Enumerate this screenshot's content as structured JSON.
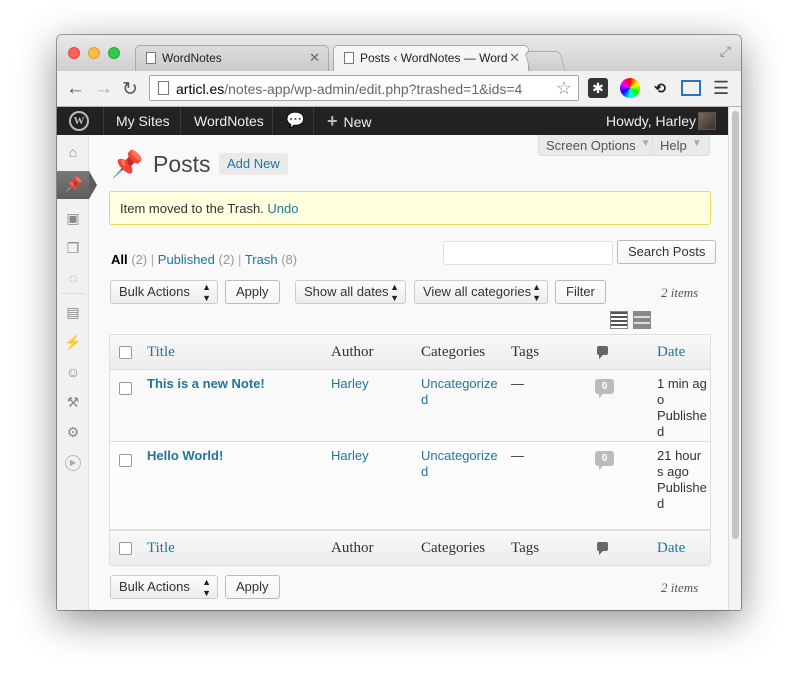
{
  "browser": {
    "tabs": [
      {
        "label": "WordNotes"
      },
      {
        "label": "Posts ‹ WordNotes — Word"
      }
    ],
    "url_host": "articl.es",
    "url_path": "/notes-app/wp-admin/edit.php?trashed=1&ids=4"
  },
  "adminbar": {
    "my_sites": "My Sites",
    "site_name": "WordNotes",
    "new": "New",
    "howdy": "Howdy, Harley"
  },
  "header": {
    "screen_options": "Screen Options",
    "help": "Help",
    "title": "Posts",
    "add_new": "Add New"
  },
  "notice": {
    "text": "Item moved to the Trash.",
    "undo": "Undo"
  },
  "filters": {
    "all_label": "All",
    "all_count": "(2)",
    "published_label": "Published",
    "published_count": "(2)",
    "trash_label": "Trash",
    "trash_count": "(8)",
    "sep": "|"
  },
  "search": {
    "button": "Search Posts",
    "placeholder": ""
  },
  "tablenav": {
    "bulk_actions": "Bulk Actions",
    "apply": "Apply",
    "dates": "Show all dates",
    "categories": "View all categories",
    "filter": "Filter",
    "items": "2 items"
  },
  "table": {
    "columns": {
      "title": "Title",
      "author": "Author",
      "categories": "Categories",
      "tags": "Tags",
      "date": "Date"
    },
    "rows": [
      {
        "title": "This is a new Note!",
        "author": "Harley",
        "category": "Uncategorized",
        "tags": "—",
        "comments": "0",
        "date": "1 min ago",
        "status": "Published"
      },
      {
        "title": "Hello World!",
        "author": "Harley",
        "category": "Uncategorized",
        "tags": "—",
        "comments": "0",
        "date": "21 hours ago",
        "status": "Published"
      }
    ]
  },
  "icons": {
    "wp_logo": "W",
    "comment_bubble": "comment-icon",
    "plus": "+"
  }
}
